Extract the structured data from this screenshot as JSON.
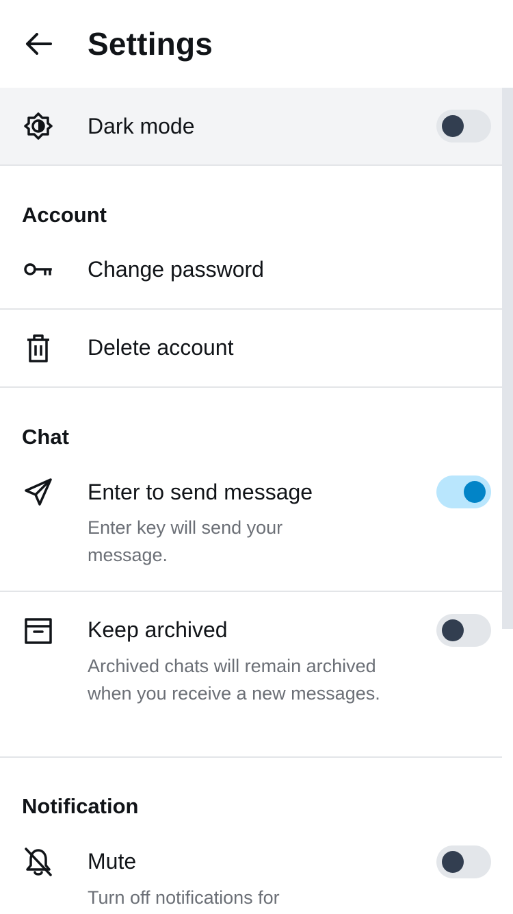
{
  "header": {
    "title": "Settings",
    "back_icon": "arrow-left-icon"
  },
  "dark_mode": {
    "label": "Dark mode",
    "icon": "contrast-icon",
    "enabled": false
  },
  "account": {
    "title": "Account",
    "change_password": {
      "label": "Change password",
      "icon": "key-icon"
    },
    "delete_account": {
      "label": "Delete account",
      "icon": "trash-icon"
    }
  },
  "chat": {
    "title": "Chat",
    "enter_to_send": {
      "label": "Enter to send message",
      "description": "Enter key will send your message.",
      "icon": "send-icon",
      "enabled": true
    },
    "keep_archived": {
      "label": "Keep archived",
      "description": "Archived chats will remain archived when you receive a new messages.",
      "icon": "archive-icon",
      "enabled": false
    }
  },
  "notification": {
    "title": "Notification",
    "mute": {
      "label": "Mute",
      "description": "Turn off notifications for",
      "icon": "bell-off-icon",
      "enabled": false
    }
  },
  "colors": {
    "toggle_on_track": "#b9e6fd",
    "toggle_on_knob": "#0284c7",
    "toggle_off_track": "#e3e6ea",
    "toggle_off_knob": "#323e50"
  }
}
